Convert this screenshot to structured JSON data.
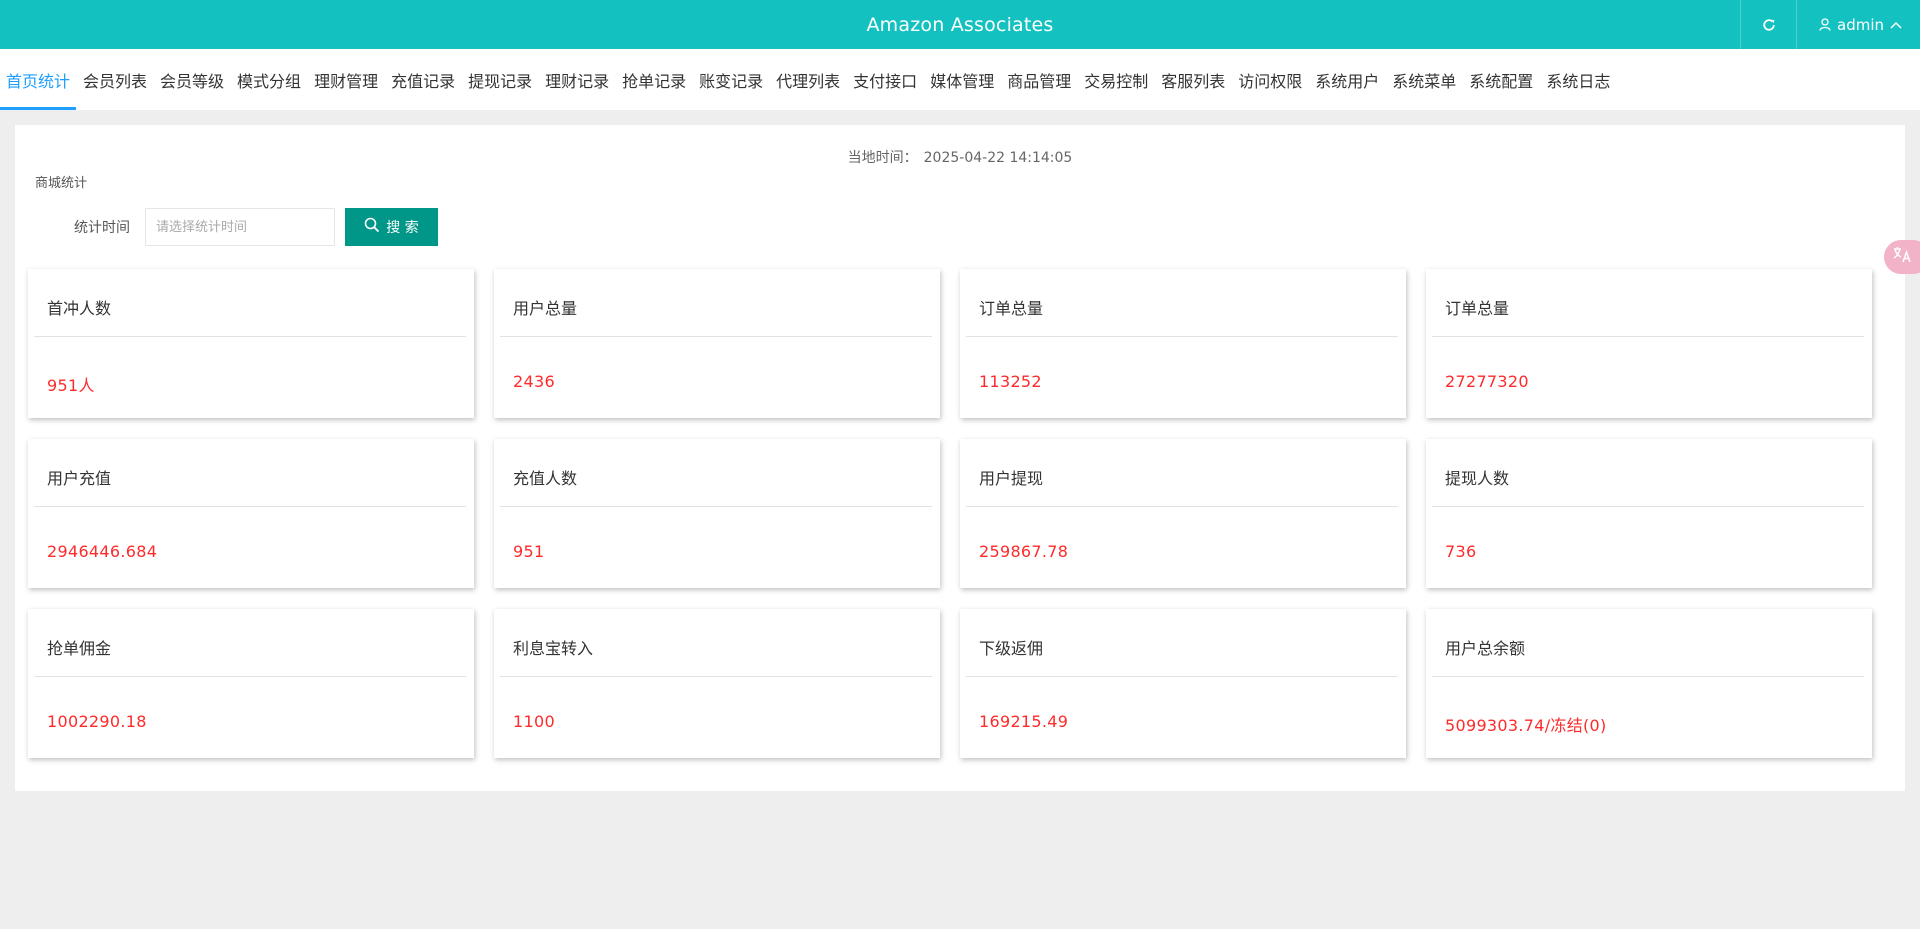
{
  "header": {
    "title": "Amazon Associates",
    "user": "admin",
    "bg_color": "#14c1c1"
  },
  "nav": {
    "tabs": [
      {
        "label": "首页统计",
        "active": true
      },
      {
        "label": "会员列表"
      },
      {
        "label": "会员等级"
      },
      {
        "label": "模式分组"
      },
      {
        "label": "理财管理"
      },
      {
        "label": "充值记录"
      },
      {
        "label": "提现记录"
      },
      {
        "label": "理财记录"
      },
      {
        "label": "抢单记录"
      },
      {
        "label": "账变记录"
      },
      {
        "label": "代理列表"
      },
      {
        "label": "支付接口"
      },
      {
        "label": "媒体管理"
      },
      {
        "label": "商品管理"
      },
      {
        "label": "交易控制"
      },
      {
        "label": "客服列表"
      },
      {
        "label": "访问权限"
      },
      {
        "label": "系统用户"
      },
      {
        "label": "系统菜单"
      },
      {
        "label": "系统配置"
      },
      {
        "label": "系统日志"
      }
    ]
  },
  "main": {
    "local_time_label": "当地时间：",
    "local_time_value": "2025-04-22 14:14:05",
    "section_title": "商城统计",
    "filter": {
      "label": "统计时间",
      "placeholder": "请选择统计时间",
      "search_label": "搜 索"
    },
    "cards": [
      {
        "title": "首冲人数",
        "value": "951人"
      },
      {
        "title": "用户总量",
        "value": "2436"
      },
      {
        "title": "订单总量",
        "value": "113252"
      },
      {
        "title": "订单总量",
        "value": "27277320"
      },
      {
        "title": "用户充值",
        "value": "2946446.684"
      },
      {
        "title": "充值人数",
        "value": "951"
      },
      {
        "title": "用户提现",
        "value": "259867.78"
      },
      {
        "title": "提现人数",
        "value": "736"
      },
      {
        "title": "抢单佣金",
        "value": "1002290.18"
      },
      {
        "title": "利息宝转入",
        "value": "1100"
      },
      {
        "title": "下级返佣",
        "value": "169215.49"
      },
      {
        "title": "用户总余额",
        "value": "5099303.74/冻结(0)"
      }
    ]
  },
  "colors": {
    "accent": "#14c1c1",
    "active_tab": "#1e9fff",
    "search_button": "#009688",
    "value_text": "#ff2a2a"
  },
  "icons": {
    "refresh": "refresh-icon",
    "user": "user-icon",
    "chevron": "chevron-up-icon",
    "search": "search-icon",
    "translate": "translate-icon"
  }
}
